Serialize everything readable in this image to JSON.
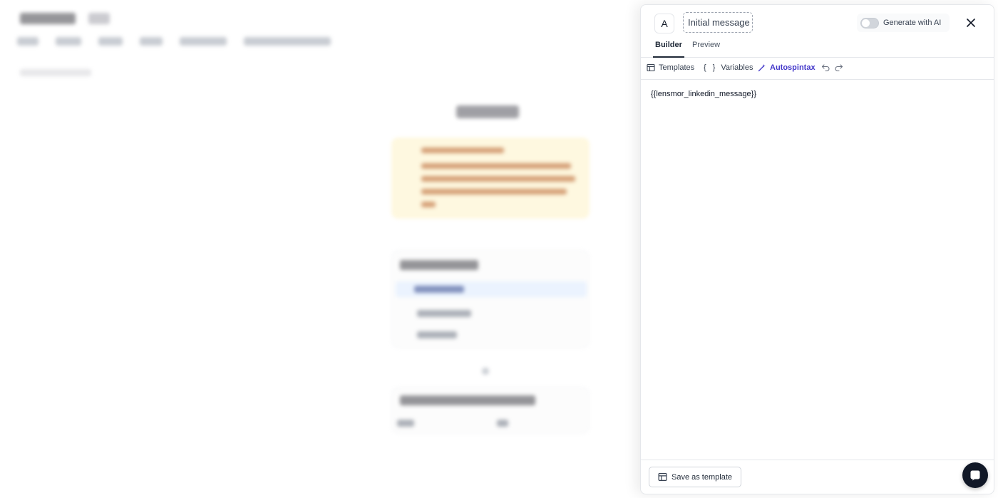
{
  "modal": {
    "avatar_letter": "A",
    "title": "Initial message",
    "ai_toggle": {
      "label": "Generate with AI",
      "on": false
    },
    "tabs": [
      {
        "label": "Builder",
        "active": true
      },
      {
        "label": "Preview",
        "active": false
      }
    ],
    "toolbar": {
      "templates_label": "Templates",
      "variables_label": "Variables",
      "autospintax_label": "Autospintax"
    },
    "editor_content": "{{lensmor_linkedin_message}}",
    "save_template_label": "Save as template"
  },
  "colors": {
    "accent": "#4338ca",
    "chat_bubble": "#111827"
  },
  "icons": [
    "close-icon",
    "templates-icon",
    "variables-icon",
    "autospintax-wand-icon",
    "undo-icon",
    "redo-icon",
    "save-template-icon",
    "chat-icon"
  ]
}
